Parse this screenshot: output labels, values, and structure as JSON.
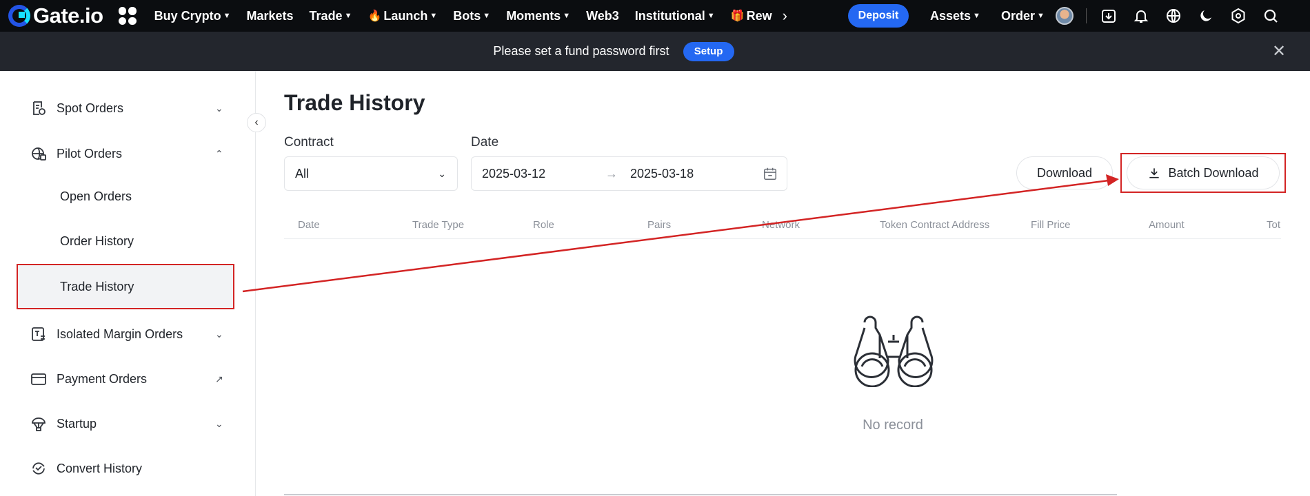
{
  "nav": {
    "logo": "Gate.io",
    "items": [
      {
        "label": "Buy Crypto",
        "caret": true
      },
      {
        "label": "Markets",
        "caret": false
      },
      {
        "label": "Trade",
        "caret": true
      },
      {
        "label": "Launch",
        "caret": true
      },
      {
        "label": "Bots",
        "caret": true
      },
      {
        "label": "Moments",
        "caret": true
      },
      {
        "label": "Web3",
        "caret": false
      },
      {
        "label": "Institutional",
        "caret": true
      },
      {
        "label": "Rew",
        "caret": false
      }
    ],
    "deposit": "Deposit",
    "assets": "Assets",
    "order": "Order"
  },
  "banner": {
    "text": "Please set a fund password first",
    "setup": "Setup"
  },
  "sidebar": {
    "items": [
      {
        "label": "Spot Orders",
        "icon": "spot-orders-icon",
        "arrow": "chevron-down"
      },
      {
        "label": "Pilot Orders",
        "icon": "pilot-orders-icon",
        "arrow": "chevron-up"
      },
      {
        "label": "Isolated Margin Orders",
        "icon": "margin-orders-icon",
        "arrow": "chevron-down"
      },
      {
        "label": "Payment Orders",
        "icon": "payment-orders-icon",
        "arrow": "external-link"
      },
      {
        "label": "Startup",
        "icon": "startup-icon",
        "arrow": "chevron-down"
      },
      {
        "label": "Convert History",
        "icon": "convert-history-icon",
        "arrow": "none"
      }
    ],
    "subitems": [
      {
        "label": "Open Orders"
      },
      {
        "label": "Order History"
      },
      {
        "label": "Trade History",
        "active": true
      }
    ]
  },
  "main": {
    "title": "Trade History",
    "contract_label": "Contract",
    "contract_value": "All",
    "date_label": "Date",
    "date_from": "2025-03-12",
    "date_to": "2025-03-18",
    "download": "Download",
    "batch_download": "Batch Download",
    "columns": [
      "Date",
      "Trade Type",
      "Role",
      "Pairs",
      "Network",
      "Token Contract Address",
      "Fill Price",
      "Amount",
      "Tot"
    ],
    "empty_text": "No record"
  },
  "colors": {
    "accent": "#2468f2",
    "highlight": "#d32424",
    "nav_bg": "#0b0d10",
    "banner_bg": "#23262d"
  }
}
